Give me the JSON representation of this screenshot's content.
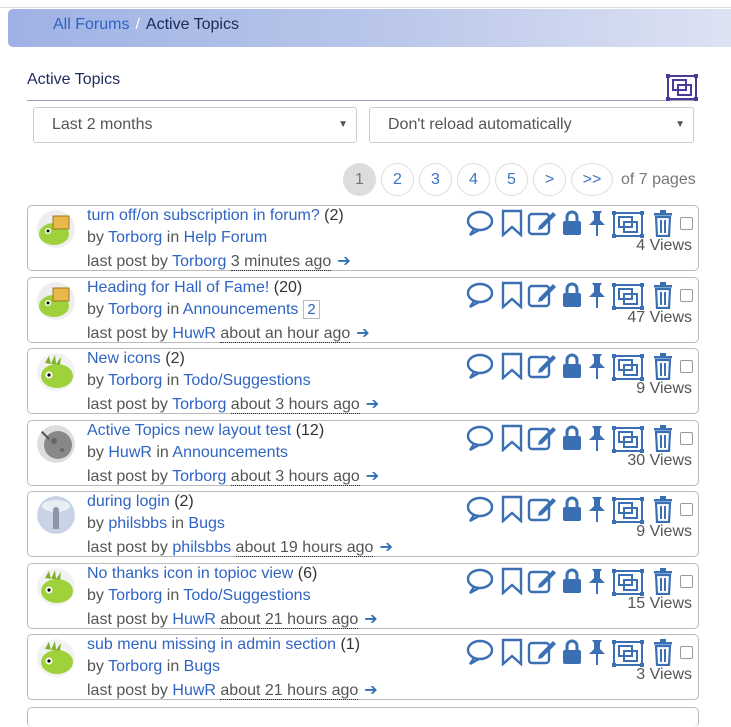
{
  "breadcrumb": {
    "root": "All Forums",
    "separator": "/",
    "current": "Active Topics"
  },
  "section_title": "Active Topics",
  "filters": {
    "time_range": "Last 2 months",
    "reload": "Don't reload automatically"
  },
  "pagination": {
    "pages": [
      "1",
      "2",
      "3",
      "4",
      "5",
      ">",
      ">>"
    ],
    "active": "1",
    "summary": "of 7 pages"
  },
  "labels": {
    "by": "by",
    "in": "in",
    "last_post_by": "last post by"
  },
  "topics": [
    {
      "title": "turn off/on subscription in forum?",
      "count": "(2)",
      "author": "Torborg",
      "forum": "Help Forum",
      "last_user": "Torborg",
      "last_time": "3 minutes ago",
      "views": "4 Views",
      "avatar": "folder"
    },
    {
      "title": "Heading for Hall of Fame!",
      "count": "(20)",
      "author": "Torborg",
      "forum": "Announcements",
      "badge": "2",
      "last_user": "HuwR",
      "last_time": "about an hour ago",
      "views": "47 Views",
      "avatar": "folder"
    },
    {
      "title": "New icons",
      "count": "(2)",
      "author": "Torborg",
      "forum": "Todo/Suggestions",
      "last_user": "Torborg",
      "last_time": "about 3 hours ago",
      "views": "9 Views",
      "avatar": "lizard"
    },
    {
      "title": "Active Topics new layout test",
      "count": "(12)",
      "author": "HuwR",
      "forum": "Announcements",
      "last_user": "Torborg",
      "last_time": "about 3 hours ago",
      "views": "30 Views",
      "avatar": "moon"
    },
    {
      "title": "during login",
      "count": "(2)",
      "author": "philsbbs",
      "forum": "Bugs",
      "last_user": "philsbbs",
      "last_time": "about 19 hours ago",
      "views": "9 Views",
      "avatar": "photo"
    },
    {
      "title": "No thanks icon in topioc view",
      "count": "(6)",
      "author": "Torborg",
      "forum": "Todo/Suggestions",
      "last_user": "HuwR",
      "last_time": "about 21 hours ago",
      "views": "15 Views",
      "avatar": "lizard"
    },
    {
      "title": "sub menu missing in admin section",
      "count": "(1)",
      "author": "Torborg",
      "forum": "Bugs",
      "last_user": "HuwR",
      "last_time": "about 21 hours ago",
      "views": "3 Views",
      "avatar": "lizard"
    }
  ],
  "icons": [
    "reply-icon",
    "bookmark-icon",
    "edit-icon",
    "lock-icon",
    "pin-icon",
    "move-icon",
    "delete-icon"
  ],
  "colors": {
    "accent": "#2f64c2",
    "breadcrumb_start": "#9fb2e4",
    "icon": "#3a6fb4",
    "title_text": "#1e2b5c"
  }
}
